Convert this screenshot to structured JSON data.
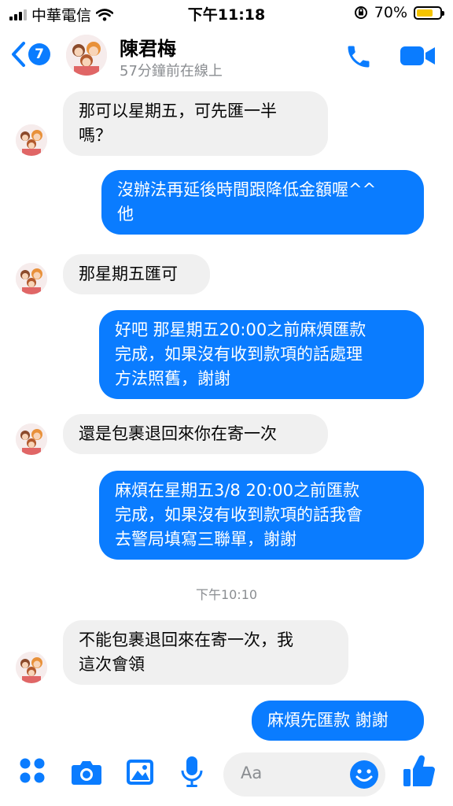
{
  "status_bar": {
    "carrier": "中華電信",
    "time": "下午11:18",
    "battery": "70%",
    "battery_level": 0.7
  },
  "header": {
    "back_count": "7",
    "contact_name": "陳君梅",
    "contact_status": "57分鐘前在線上",
    "icons": [
      "chevron-left-icon",
      "phone-icon",
      "video-camera-icon"
    ]
  },
  "messages": [
    {
      "dir": "in",
      "text": "那可以星期五，可先匯一半\n嗎？"
    },
    {
      "dir": "out",
      "text": "沒辦法再延後時間跟降低金額喔^^\n他"
    },
    {
      "dir": "in",
      "text": "那星期五匯可"
    },
    {
      "dir": "out",
      "text": "好吧 那星期五20:00之前麻煩匯款\n完成，如果沒有收到款項的話處理\n方法照舊，謝謝"
    },
    {
      "dir": "in",
      "text": "還是包裹退回來你在寄一次"
    },
    {
      "dir": "out",
      "text": "麻煩在星期五3/8 20:00之前匯款\n完成，如果沒有收到款項的話我會\n去警局填寫三聯單，謝謝"
    },
    {
      "dir": "in",
      "text": "不能包裹退回來在寄一次，我\n這次會領"
    },
    {
      "dir": "out",
      "text": "麻煩先匯款 謝謝"
    }
  ],
  "timestamp": "下午10:10",
  "composer": {
    "placeholder": "Aa",
    "icons": [
      "apps-icon",
      "camera-icon",
      "image-icon",
      "microphone-icon",
      "emoji-icon",
      "thumbs-up-icon"
    ]
  },
  "colors": {
    "accent": "#0a7cff",
    "incoming_bubble": "#f0f0f0",
    "secondary_text": "#8a8d91"
  }
}
